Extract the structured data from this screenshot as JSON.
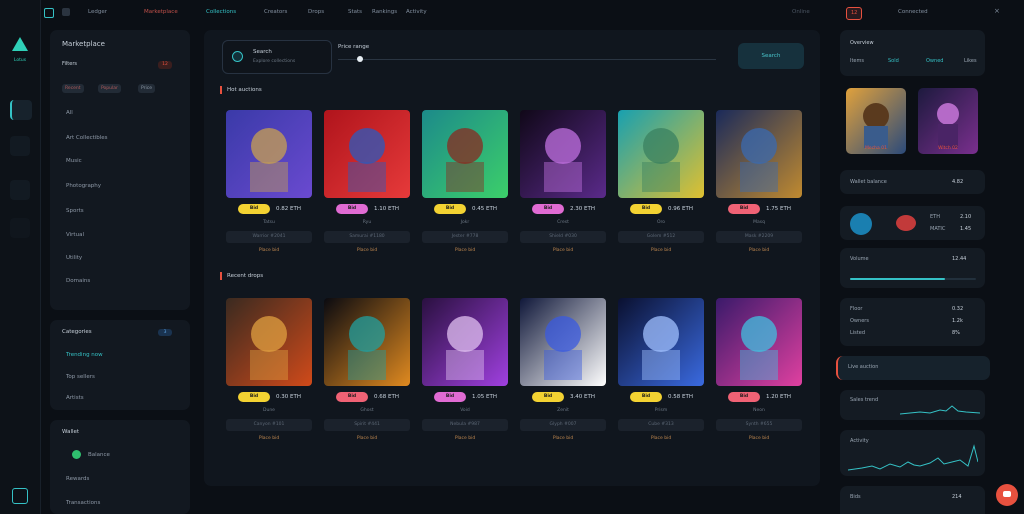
{
  "brand": {
    "name": "Lotus",
    "accent": "#35c2c6",
    "alert": "#e8513f"
  },
  "topbar": {
    "left_icons": [
      "grid-icon",
      "wallet-icon"
    ],
    "items": [
      "Ledger",
      "Marketplace",
      "Collections",
      "Creators",
      "Drops",
      "Stats",
      "Rankings",
      "Activity"
    ],
    "active_index": 2,
    "status": "Online",
    "badge": "12",
    "account": "Connected",
    "close_glyph": "×"
  },
  "left_panel": {
    "title": "Marketplace",
    "filter_label": "Filters",
    "filter_count": "12",
    "chips": [
      "Recent",
      "Popular",
      "Price"
    ],
    "rows": [
      "All",
      "Art Collectibles",
      "Music",
      "Photography",
      "Sports",
      "Virtual",
      "Utility",
      "Domains"
    ]
  },
  "left_panel2": {
    "title": "Categories",
    "badge": "3",
    "rows": [
      "Trending now",
      "Top sellers",
      "Artists"
    ]
  },
  "left_panel3": {
    "title": "Wallet",
    "rows": [
      "Balance",
      "Rewards",
      "Transactions"
    ]
  },
  "search": {
    "label": "Search",
    "sub": "Explore collections",
    "slider_label": "Price range",
    "slider_value": 0.2,
    "button": "Search"
  },
  "sections": [
    "Hot auctions",
    "Recent drops"
  ],
  "cards_row1": [
    {
      "pill": "Bid",
      "pill_color": "#f3d232",
      "price": "0.82 ETH",
      "sub": "Tatsu",
      "bar": "Warrior #2041",
      "foot": "Place bid"
    },
    {
      "pill": "Bid",
      "pill_color": "#e06bd3",
      "price": "1.10 ETH",
      "sub": "Ryu",
      "bar": "Samurai #1180",
      "foot": "Place bid"
    },
    {
      "pill": "Bid",
      "pill_color": "#f3d232",
      "price": "0.45 ETH",
      "sub": "Jokr",
      "bar": "Jester #778",
      "foot": "Place bid"
    },
    {
      "pill": "Bid",
      "pill_color": "#e06bd3",
      "price": "2.30 ETH",
      "sub": "Crest",
      "bar": "Shield #030",
      "foot": "Place bid"
    },
    {
      "pill": "Bid",
      "pill_color": "#f3d232",
      "price": "0.96 ETH",
      "sub": "Oro",
      "bar": "Golem #512",
      "foot": "Place bid"
    },
    {
      "pill": "Bid",
      "pill_color": "#f06275",
      "price": "1.75 ETH",
      "sub": "Masq",
      "bar": "Mask #2209",
      "foot": "Place bid"
    }
  ],
  "cards_row2": [
    {
      "pill": "Bid",
      "pill_color": "#f3d232",
      "price": "0.30 ETH",
      "sub": "Dune",
      "bar": "Canyon #101",
      "foot": "Place bid"
    },
    {
      "pill": "Bid",
      "pill_color": "#f06275",
      "price": "0.68 ETH",
      "sub": "Ghost",
      "bar": "Spirit #441",
      "foot": "Place bid"
    },
    {
      "pill": "Bid",
      "pill_color": "#e06bd3",
      "price": "1.05 ETH",
      "sub": "Void",
      "bar": "Nebula #987",
      "foot": "Place bid"
    },
    {
      "pill": "Bid",
      "pill_color": "#f3d232",
      "price": "3.40 ETH",
      "sub": "Zenit",
      "bar": "Glyph #007",
      "foot": "Place bid"
    },
    {
      "pill": "Bid",
      "pill_color": "#f3d232",
      "price": "0.58 ETH",
      "sub": "Prism",
      "bar": "Cube #313",
      "foot": "Place bid"
    },
    {
      "pill": "Bid",
      "pill_color": "#f06275",
      "price": "1.20 ETH",
      "sub": "Neon",
      "bar": "Synth #655",
      "foot": "Place bid"
    }
  ],
  "right": {
    "profile_title": "Overview",
    "profile_tabs": [
      "Items",
      "Sold",
      "Owned",
      "Likes"
    ],
    "featured": [
      {
        "caption": "Mecha 01"
      },
      {
        "caption": "Witch 02"
      }
    ],
    "wallet_label": "Wallet balance",
    "wallet_value": "4.82",
    "tokens": [
      "ETH",
      "MATIC"
    ],
    "token_values": [
      "2.10",
      "1.45"
    ],
    "stats_title": "Volume",
    "stats_value": "12.44",
    "list_rows": [
      "Floor",
      "Owners",
      "Listed"
    ],
    "list_values": [
      "0.32",
      "1.2k",
      "8%"
    ],
    "alert_label": "Live auction",
    "chart1_title": "Sales trend",
    "chart2_title": "Activity",
    "bottom_title": "Bids",
    "bottom_value": "214"
  }
}
